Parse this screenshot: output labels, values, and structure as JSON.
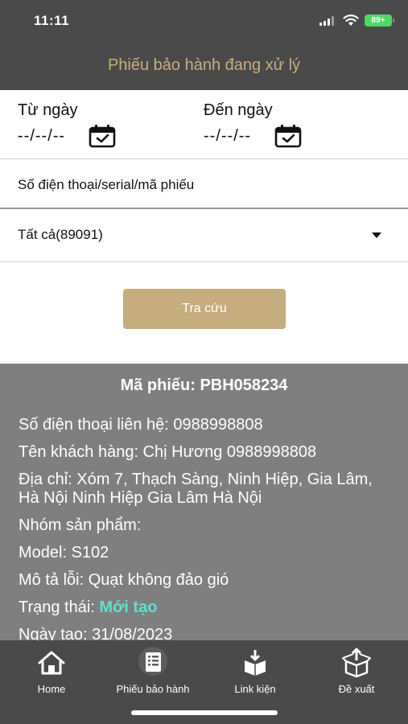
{
  "status_bar": {
    "time": "11:11",
    "battery": "89+"
  },
  "header": {
    "title": "Phiếu bảo hành đang xử lý"
  },
  "filters": {
    "from_label": "Từ ngày",
    "from_value": "--/--/--",
    "to_label": "Đến ngày",
    "to_value": "--/--/--",
    "search_placeholder": "Số điện thoại/serial/mã phiếu",
    "select_value": "Tất cả(89091)",
    "submit_label": "Tra cứu"
  },
  "ticket": {
    "code": "Mã phiếu: PBH058234",
    "phone": "Số điện thoại liên hệ: 0988998808",
    "customer": "Tên khách hàng: Chị Hương 0988998808",
    "address": "Địa chỉ: Xóm 7, Thạch Sàng, Ninh Hiệp, Gia Lâm, Hà Nội Ninh Hiệp Gia Lâm Hà Nội",
    "product_group": "Nhóm sản phẩm:",
    "model": "Model: S102",
    "error": "Mô tả lỗi: Quạt không đảo gió",
    "status_label": "Trạng thái: ",
    "status_value": "Mới tạo",
    "created": "Ngày tạo: 31/08/2023"
  },
  "tabs": [
    {
      "label": "Home",
      "icon": "home-icon"
    },
    {
      "label": "Phiếu bảo hành",
      "icon": "document-list-icon",
      "active": true
    },
    {
      "label": "Link kiện",
      "icon": "box-download-icon"
    },
    {
      "label": "Đề xuất",
      "icon": "box-upload-icon"
    }
  ],
  "colors": {
    "header_bg": "#4a4a4a",
    "accent": "#c6ad7f",
    "card_bg": "#7f7f7f",
    "status_new": "#5de0d0",
    "battery": "#4cd964"
  }
}
